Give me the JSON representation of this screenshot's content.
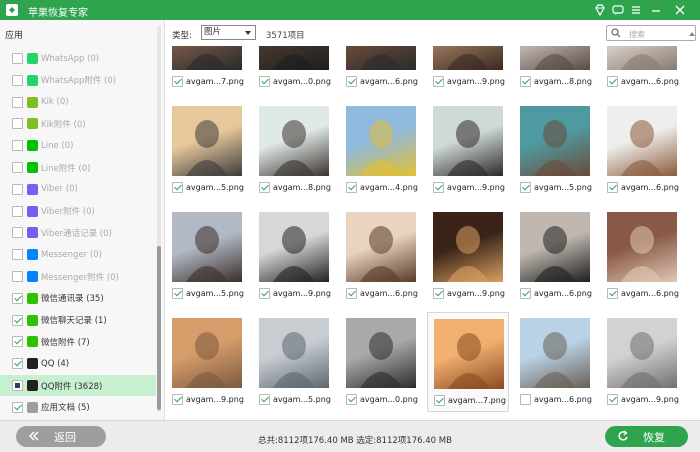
{
  "app": {
    "title": "苹果恢复专家"
  },
  "sidebar": {
    "section": "应用",
    "items": [
      {
        "label": "WhatsApp (0)",
        "icon": "whatsapp-icon",
        "color": "#25d366",
        "state": "empty",
        "muted": true
      },
      {
        "label": "WhatsApp附件 (0)",
        "icon": "whatsapp-icon",
        "color": "#25d366",
        "state": "empty",
        "muted": true
      },
      {
        "label": "Kik (0)",
        "icon": "kik-icon",
        "color": "#82bc23",
        "state": "empty",
        "muted": true
      },
      {
        "label": "Kik附件 (0)",
        "icon": "kik-icon",
        "color": "#82bc23",
        "state": "empty",
        "muted": true
      },
      {
        "label": "Line (0)",
        "icon": "line-icon",
        "color": "#00c300",
        "state": "empty",
        "muted": true
      },
      {
        "label": "Line附件 (0)",
        "icon": "line-icon",
        "color": "#00c300",
        "state": "empty",
        "muted": true
      },
      {
        "label": "Viber (0)",
        "icon": "viber-icon",
        "color": "#7360f2",
        "state": "empty",
        "muted": true
      },
      {
        "label": "Viber附件 (0)",
        "icon": "viber-icon",
        "color": "#7360f2",
        "state": "empty",
        "muted": true
      },
      {
        "label": "Viber通话记录 (0)",
        "icon": "viber-icon",
        "color": "#7360f2",
        "state": "empty",
        "muted": true
      },
      {
        "label": "Messenger (0)",
        "icon": "messenger-icon",
        "color": "#0084ff",
        "state": "empty",
        "muted": true
      },
      {
        "label": "Messenger附件 (0)",
        "icon": "messenger-icon",
        "color": "#0084ff",
        "state": "empty",
        "muted": true
      },
      {
        "label": "微信通讯录 (35)",
        "icon": "wechat-icon",
        "color": "#2dc100",
        "state": "checked",
        "muted": false
      },
      {
        "label": "微信聊天记录 (1)",
        "icon": "wechat-icon",
        "color": "#2dc100",
        "state": "checked",
        "muted": false
      },
      {
        "label": "微信附件 (7)",
        "icon": "wechat-icon",
        "color": "#2dc100",
        "state": "checked",
        "muted": false
      },
      {
        "label": "QQ (4)",
        "icon": "qq-icon",
        "color": "#222222",
        "state": "checked",
        "muted": false
      },
      {
        "label": "QQ附件 (3628)",
        "icon": "qq-icon",
        "color": "#222222",
        "state": "partial",
        "muted": false,
        "selected": true
      },
      {
        "label": "应用文档 (5)",
        "icon": "document-icon",
        "color": "#9e9e9e",
        "state": "checked",
        "muted": false
      }
    ]
  },
  "toolbar": {
    "type_label": "类型:",
    "type_value": "图片",
    "count": "3571项目",
    "search_placeholder": "搜索"
  },
  "grid": {
    "rows": [
      [
        {
          "name": "avgam...7.png",
          "checked": true,
          "colors": [
            "#7a5a4a",
            "#2a2a2a"
          ]
        },
        {
          "name": "avgam...0.png",
          "checked": true,
          "colors": [
            "#4a3a30",
            "#1e1e1e"
          ]
        },
        {
          "name": "avgam...6.png",
          "checked": true,
          "colors": [
            "#6d4b3c",
            "#2b2b2b"
          ]
        },
        {
          "name": "avgam...9.png",
          "checked": true,
          "colors": [
            "#9e7b5e",
            "#3a2a22"
          ]
        },
        {
          "name": "avgam...8.png",
          "checked": true,
          "colors": [
            "#c8bfb8",
            "#5a4a44"
          ]
        },
        {
          "name": "avgam...6.png",
          "checked": true,
          "colors": [
            "#dcd6d0",
            "#8a7a70"
          ]
        }
      ],
      [
        {
          "name": "avgam...5.png",
          "checked": true,
          "colors": [
            "#e7c89a",
            "#3c3c3c"
          ]
        },
        {
          "name": "avgam...8.png",
          "checked": true,
          "colors": [
            "#dfe9e6",
            "#3b3430"
          ]
        },
        {
          "name": "avgam...4.png",
          "checked": true,
          "colors": [
            "#8fb9dd",
            "#e2c033"
          ]
        },
        {
          "name": "avgam...9.png",
          "checked": true,
          "colors": [
            "#cfd9d5",
            "#2d2a28"
          ]
        },
        {
          "name": "avgam...5.png",
          "checked": true,
          "colors": [
            "#4f9aa0",
            "#6b4a38"
          ]
        },
        {
          "name": "avgam...6.png",
          "checked": true,
          "colors": [
            "#eeeeec",
            "#8b5a3a"
          ]
        }
      ],
      [
        {
          "name": "avgam...5.png",
          "checked": true,
          "colors": [
            "#b2b9c5",
            "#3a2e2a"
          ]
        },
        {
          "name": "avgam...9.png",
          "checked": true,
          "colors": [
            "#d7d7d7",
            "#222222"
          ]
        },
        {
          "name": "avgam...6.png",
          "checked": true,
          "colors": [
            "#e9d5bf",
            "#5a3a28"
          ]
        },
        {
          "name": "avgam...9.png",
          "checked": true,
          "colors": [
            "#3a2418",
            "#d8a060"
          ]
        },
        {
          "name": "avgam...6.png",
          "checked": true,
          "colors": [
            "#c0b8b0",
            "#1f1f1f"
          ]
        },
        {
          "name": "avgam...6.png",
          "checked": true,
          "colors": [
            "#8a5a48",
            "#e0c8b4"
          ]
        }
      ],
      [
        {
          "name": "avgam...9.png",
          "checked": true,
          "colors": [
            "#d69c6a",
            "#7a5a40"
          ]
        },
        {
          "name": "avgam...5.png",
          "checked": true,
          "colors": [
            "#c8cdd2",
            "#5e6670"
          ]
        },
        {
          "name": "avgam...0.png",
          "checked": true,
          "colors": [
            "#a9a9a9",
            "#2c2c2c"
          ]
        },
        {
          "name": "avgam...7.png",
          "checked": true,
          "focused": true,
          "colors": [
            "#f0b070",
            "#8a4a20"
          ]
        },
        {
          "name": "avgam...6.png",
          "checked": false,
          "colors": [
            "#b9d2e6",
            "#6a6055"
          ]
        },
        {
          "name": "avgam...9.png",
          "checked": true,
          "colors": [
            "#d2d2d2",
            "#707070"
          ]
        }
      ]
    ]
  },
  "footer": {
    "back_label": "返回",
    "total": "总共:8112项176.40 MB 选定:8112项176.40 MB",
    "recover_label": "恢复"
  },
  "colors": {
    "brand": "#2ea44f",
    "selected_row": "#c7f0d1"
  }
}
